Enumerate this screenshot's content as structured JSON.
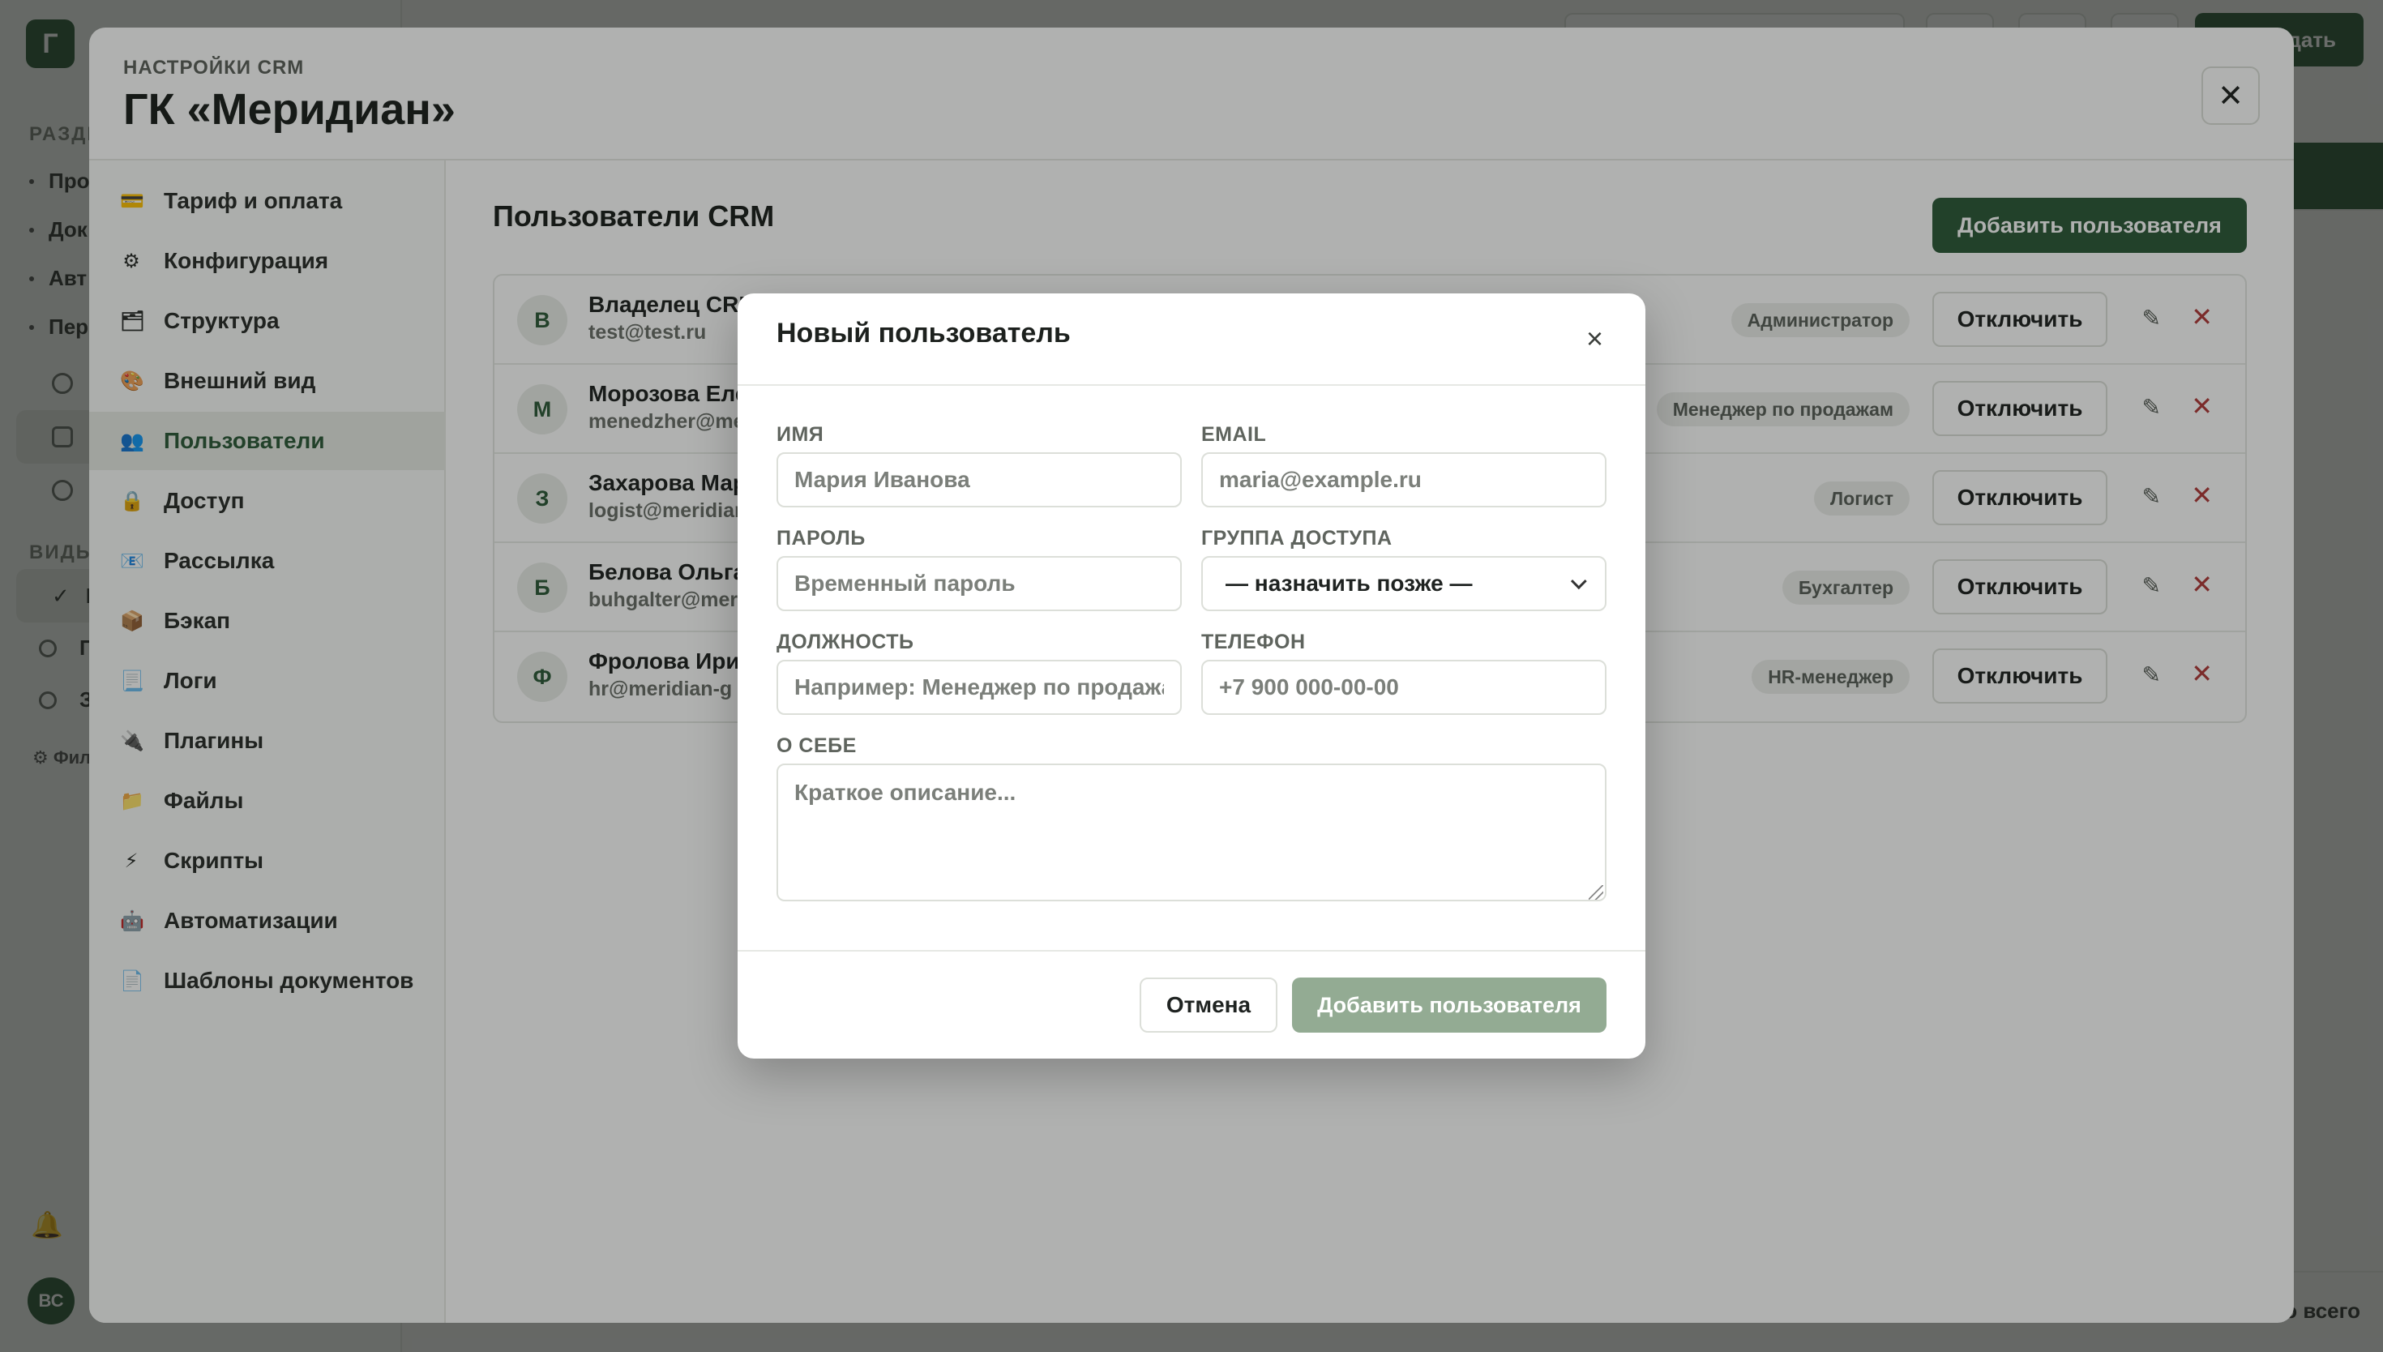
{
  "background_app": {
    "logo_letter": "Г",
    "section_label": "РАЗДЕ",
    "nav_items": [
      "Про",
      "Док",
      "Авт",
      "Пер"
    ],
    "views_label": "ВИДЫ",
    "view_items": [
      "В",
      "П",
      "З"
    ],
    "filter_label": "Фил",
    "avatar_initials": "ВС",
    "primary_action_fragment": "дать",
    "total_fragment": "о всего"
  },
  "settings": {
    "eyebrow": "НАСТРОЙКИ CRM",
    "title": "ГК «Меридиан»",
    "close_glyph": "✕",
    "nav": [
      {
        "icon": "💳",
        "label": "Тариф и оплата"
      },
      {
        "icon": "⚙",
        "label": "Конфигурация"
      },
      {
        "icon": "🗂",
        "label": "Структура"
      },
      {
        "icon": "🎨",
        "label": "Внешний вид"
      },
      {
        "icon": "👥",
        "label": "Пользователи"
      },
      {
        "icon": "🔒",
        "label": "Доступ"
      },
      {
        "icon": "📧",
        "label": "Рассылка"
      },
      {
        "icon": "📦",
        "label": "Бэкап"
      },
      {
        "icon": "📃",
        "label": "Логи"
      },
      {
        "icon": "🔌",
        "label": "Плагины"
      },
      {
        "icon": "📁",
        "label": "Файлы"
      },
      {
        "icon": "⚡",
        "label": "Скрипты"
      },
      {
        "icon": "🤖",
        "label": "Автоматизации"
      },
      {
        "icon": "📄",
        "label": "Шаблоны документов"
      }
    ],
    "active_nav": "Пользователи",
    "users_title": "Пользователи CRM",
    "add_user_label": "Добавить пользователя",
    "users": [
      {
        "initial": "В",
        "name": "Владелец CRM",
        "email": "test@test.ru",
        "role": "Администратор",
        "action": "Отключить"
      },
      {
        "initial": "М",
        "name": "Морозова Еле",
        "email": "menedzher@me",
        "role": "Менеджер по продажам",
        "action": "Отключить"
      },
      {
        "initial": "З",
        "name": "Захарова Мар",
        "email": "logist@meridian",
        "role": "Логист",
        "action": "Отключить"
      },
      {
        "initial": "Б",
        "name": "Белова Ольга",
        "email": "buhgalter@mer",
        "role": "Бухгалтер",
        "action": "Отключить"
      },
      {
        "initial": "Ф",
        "name": "Фролова Ири",
        "email": "hr@meridian-g",
        "role": "HR-менеджер",
        "action": "Отключить"
      }
    ]
  },
  "dialog": {
    "title": "Новый пользователь",
    "close_glyph": "×",
    "name_label": "ИМЯ",
    "name_placeholder": "Мария Иванова",
    "email_label": "EMAIL",
    "email_placeholder": "maria@example.ru",
    "password_label": "ПАРОЛЬ",
    "password_placeholder": "Временный пароль",
    "group_label": "ГРУППА ДОСТУПА",
    "group_value": "— назначить позже —",
    "position_label": "ДОЛЖНОСТЬ",
    "position_placeholder": "Например: Менеджер по продажам",
    "phone_label": "ТЕЛЕФОН",
    "phone_placeholder": "+7 900 000-00-00",
    "about_label": "О СЕБЕ",
    "about_placeholder": "Краткое описание...",
    "cancel_label": "Отмена",
    "submit_label": "Добавить пользователя"
  },
  "colors": {
    "brand_green": "#2f5a3a",
    "submit_disabled": "#93ab93",
    "delete_red": "#b23a3a"
  }
}
